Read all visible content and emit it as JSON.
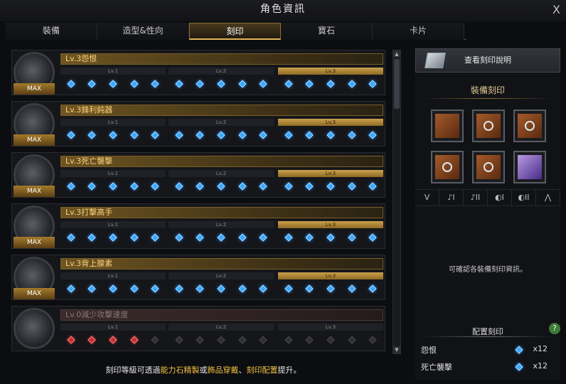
{
  "window": {
    "title": "角色資訊",
    "close": "X"
  },
  "tabs": [
    "裝備",
    "造型&性向",
    "刻印",
    "寶石",
    "卡片"
  ],
  "active_tab": "刻印",
  "engravings": [
    {
      "name": "Lv.3怨恨",
      "badge": "MAX",
      "levels": [
        "Lv.1",
        "Lv.2",
        "Lv.3"
      ],
      "active_level": 3,
      "nodes": 15,
      "filled": 15
    },
    {
      "name": "Lv.3鋒利鈍器",
      "badge": "MAX",
      "levels": [
        "Lv.1",
        "Lv.2",
        "Lv.3"
      ],
      "active_level": 3,
      "nodes": 15,
      "filled": 15
    },
    {
      "name": "Lv.3死亡襲擊",
      "badge": "MAX",
      "levels": [
        "Lv.1",
        "Lv.2",
        "Lv.3"
      ],
      "active_level": 3,
      "nodes": 15,
      "filled": 15
    },
    {
      "name": "Lv.3打擊高手",
      "badge": "MAX",
      "levels": [
        "Lv.1",
        "Lv.2",
        "Lv.3"
      ],
      "active_level": 3,
      "nodes": 15,
      "filled": 15
    },
    {
      "name": "Lv.3背上腺素",
      "badge": "MAX",
      "levels": [
        "Lv.1",
        "Lv.2",
        "Lv.3"
      ],
      "active_level": 3,
      "nodes": 15,
      "filled": 15
    },
    {
      "name": "Lv.0減少攻擊速度",
      "badge": "",
      "levels": [
        "Lv.1",
        "Lv.2",
        "Lv.3"
      ],
      "active_level": 0,
      "nodes": 15,
      "filled": 4,
      "negative": true
    }
  ],
  "footer": {
    "prefix": "刻印等級可透過",
    "hl1": "能力石精製",
    "mid1": "或",
    "hl2": "飾品穿戴",
    "mid2": "、",
    "hl3": "刻印配置",
    "suffix": "提升。"
  },
  "right_panel": {
    "view_button": "查看刻印說明",
    "equip_title": "裝備刻印",
    "slots": [
      {
        "icon": "necklace-icon",
        "tier": ""
      },
      {
        "icon": "earring-icon",
        "tier": "I"
      },
      {
        "icon": "earring-icon",
        "tier": "II"
      },
      {
        "icon": "ring-icon",
        "tier": "I"
      },
      {
        "icon": "ring-icon",
        "tier": "II"
      },
      {
        "icon": "ability-stone-icon",
        "tier": ""
      }
    ],
    "filter_icons": [
      "necklace",
      "earring I",
      "earring II",
      "ring I",
      "ring II",
      "stone"
    ],
    "filter_labels": [
      "ᐯ",
      "♪I",
      "♪II",
      "◐I",
      "◐II",
      "⋀"
    ],
    "info_text": "可確認各裝備刻印資訊。",
    "config_title": "配置刻印",
    "help": "?",
    "config": [
      {
        "name": "怨恨",
        "count": "x12"
      },
      {
        "name": "死亡襲擊",
        "count": "x12"
      }
    ]
  },
  "colors": {
    "gold": "#e2b352",
    "gem_blue": "#3aa8ff",
    "gem_red": "#c43030"
  }
}
